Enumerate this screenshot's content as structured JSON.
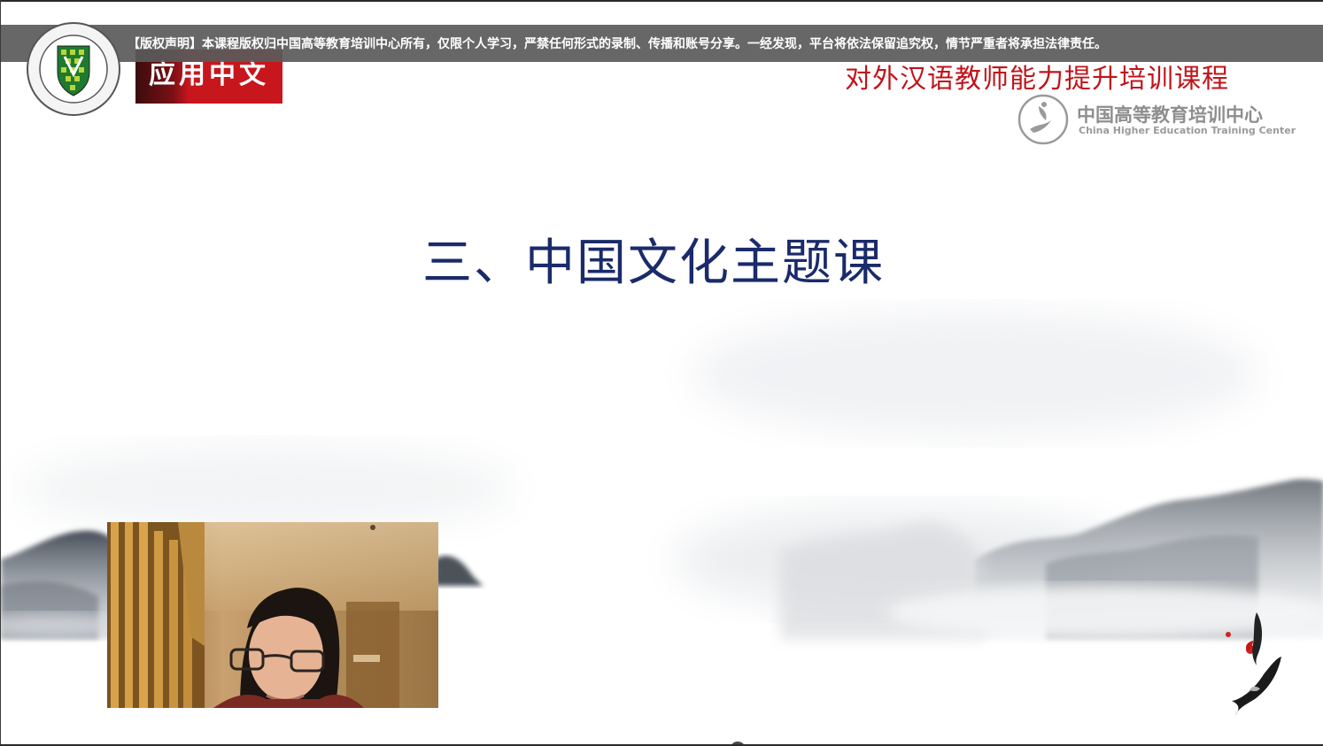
{
  "notice": {
    "text": "【版权声明】本课程版权归中国高等教育培训中心所有，仅限个人学习，严禁任何形式的录制、传播和账号分享。一经发现，平台将依法保留追究权，情节严重者将承担法律责任。"
  },
  "branding": {
    "brand_label": "应用中文",
    "course_title": "对外汉语教师能力提升培训课程",
    "center_name_cn": "中国高等教育培训中心",
    "center_name_en": "China Higher Education Training Center",
    "seal_icon": "university-seal-icon",
    "center_logo_icon": "training-center-logo-icon"
  },
  "slide": {
    "heading": "三、中国文化主题课"
  },
  "video": {
    "label_icon": "webcam-feed"
  },
  "colors": {
    "heading": "#1a2b6b",
    "course_title": "#c0141b",
    "brand_box": "#c8161d",
    "notice_bg": "#5a5a5a"
  }
}
